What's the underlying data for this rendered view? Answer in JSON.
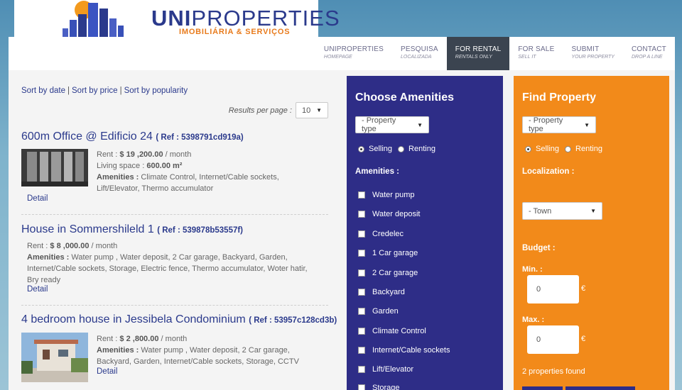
{
  "logo": {
    "title_bold": "UNI",
    "title_rest": "PROPERTIES",
    "subtitle": "IMOBILIÁRIA & SERVIÇOS"
  },
  "nav": [
    {
      "label": "UNIPROPERTIES",
      "sub": "HOMEPAGE",
      "active": false
    },
    {
      "label": "PESQUISA",
      "sub": "LOCALIZADA",
      "active": false
    },
    {
      "label": "FOR RENTAL",
      "sub": "RENTALS ONLY",
      "active": true
    },
    {
      "label": "FOR SALE",
      "sub": "SELL IT",
      "active": false
    },
    {
      "label": "SUBMIT",
      "sub": "YOUR PROPERTY",
      "active": false
    },
    {
      "label": "CONTACT",
      "sub": "DROP A LINE",
      "active": false
    }
  ],
  "sort": {
    "by_date": "Sort by date",
    "by_price": "Sort by price",
    "by_popularity": "Sort by popularity",
    "separator": "|"
  },
  "results_per_page": {
    "label": "Results per page :",
    "value": "10"
  },
  "listings": [
    {
      "title": "600m Office @ Edificio 24",
      "ref": "( Ref : 5398791cd919a)",
      "rent_label": "Rent :",
      "rent_value": "$ 19 ,200.00",
      "rent_unit": "/ month",
      "space_label": "Living space :",
      "space_value": "600.00 m²",
      "amenities_label": "Amenities :",
      "amenities_line1": "Climate Control, Internet/Cable sockets,",
      "amenities_line2": "Lift/Elevator, Thermo accumulator",
      "detail": "Detail"
    },
    {
      "title": "House in Sommershileld 1",
      "ref": "( Ref : 539878b53557f)",
      "rent_label": "Rent :",
      "rent_value": "$ 8 ,000.00",
      "rent_unit": "/ month",
      "amenities_label": "Amenities :",
      "amenities_line1": "Water pump , Water deposit, 2 Car garage, Backyard, Garden,",
      "amenities_line2": "Internet/Cable sockets, Storage, Electric fence, Thermo accumulator, Woter hatir,",
      "amenities_line3": "Bry ready",
      "detail": "Detail"
    },
    {
      "title": "4 bedroom house in Jessibela Condominium",
      "ref": "( Ref : 53957c128cd3b)",
      "rent_label": "Rent :",
      "rent_value": "$ 2 ,800.00",
      "rent_unit": "/ month",
      "amenities_label": "Amenities :",
      "amenities_line1": "Water pump , Water deposit, 2 Car garage,",
      "amenities_line2": "Backyard, Garden, Internet/Cable sockets, Storage, CCTV",
      "detail": "Detail"
    }
  ],
  "amenities_panel": {
    "title": "Choose Amenities",
    "property_type": "- Property type",
    "selling": "Selling",
    "renting": "Renting",
    "amenities_label": "Amenities :",
    "items": [
      "Water pump",
      "Water deposit",
      "Credelec",
      "1 Car garage",
      "2 Car garage",
      "Backyard",
      "Garden",
      "Climate Control",
      "Internet/Cable sockets",
      "Lift/Elevator",
      "Storage"
    ]
  },
  "find_panel": {
    "title": "Find Property",
    "property_type": "- Property type",
    "selling": "Selling",
    "renting": "Renting",
    "localization_label": "Localization :",
    "town": "- Town",
    "budget_label": "Budget :",
    "min_label": "Min. :",
    "min_value": "0",
    "max_label": "Max. :",
    "max_value": "0",
    "currency": "€",
    "found": "2 properties found"
  },
  "colors": {
    "brand_blue": "#2e2d87",
    "brand_orange": "#f28a1a",
    "nav_active": "#3b4450",
    "link_blue": "#2b3a8c"
  }
}
